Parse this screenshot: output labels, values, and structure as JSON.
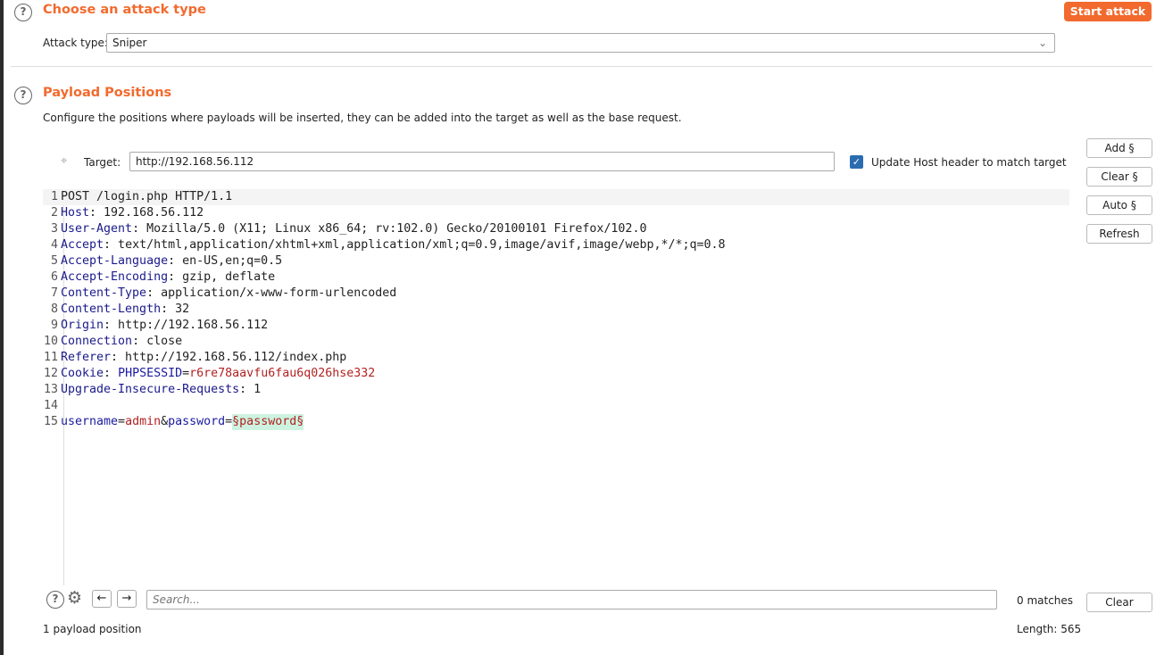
{
  "attack_section": {
    "title": "Choose an attack type",
    "start_attack": "Start attack",
    "attack_type_label": "Attack type:",
    "attack_type_value": "Sniper"
  },
  "positions_section": {
    "title": "Payload Positions",
    "description": "Configure the positions where payloads will be inserted, they can be added into the target as well as the base request.",
    "target_label": "Target:",
    "target_value": "http://192.168.56.112",
    "update_host_label": "Update Host header to match target",
    "update_host_checked": true
  },
  "side_buttons": {
    "add": "Add §",
    "clear": "Clear §",
    "auto": "Auto §",
    "refresh": "Refresh"
  },
  "request_lines": [
    [
      {
        "t": "POST /login.php HTTP/1.1",
        "c": "val"
      }
    ],
    [
      {
        "t": "Host",
        "c": "key"
      },
      {
        "t": ": 192.168.56.112",
        "c": "val"
      }
    ],
    [
      {
        "t": "User-Agent",
        "c": "key"
      },
      {
        "t": ": Mozilla/5.0 (X11; Linux x86_64; rv:102.0) Gecko/20100101 Firefox/102.0",
        "c": "val"
      }
    ],
    [
      {
        "t": "Accept",
        "c": "key"
      },
      {
        "t": ": text/html,application/xhtml+xml,application/xml;q=0.9,image/avif,image/webp,*/*;q=0.8",
        "c": "val"
      }
    ],
    [
      {
        "t": "Accept-Language",
        "c": "key"
      },
      {
        "t": ": en-US,en;q=0.5",
        "c": "val"
      }
    ],
    [
      {
        "t": "Accept-Encoding",
        "c": "key"
      },
      {
        "t": ": gzip, deflate",
        "c": "val"
      }
    ],
    [
      {
        "t": "Content-Type",
        "c": "key"
      },
      {
        "t": ": application/x-www-form-urlencoded",
        "c": "val"
      }
    ],
    [
      {
        "t": "Content-Length",
        "c": "key"
      },
      {
        "t": ": 32",
        "c": "val"
      }
    ],
    [
      {
        "t": "Origin",
        "c": "key"
      },
      {
        "t": ": http://192.168.56.112",
        "c": "val"
      }
    ],
    [
      {
        "t": "Connection",
        "c": "key"
      },
      {
        "t": ": close",
        "c": "val"
      }
    ],
    [
      {
        "t": "Referer",
        "c": "key"
      },
      {
        "t": ": http://192.168.56.112/index.php",
        "c": "val"
      }
    ],
    [
      {
        "t": "Cookie",
        "c": "key"
      },
      {
        "t": ": ",
        "c": "val"
      },
      {
        "t": "PHPSESSID",
        "c": "param"
      },
      {
        "t": "=",
        "c": "val"
      },
      {
        "t": "r6re78aavfu6fau6q026hse332",
        "c": "pval"
      }
    ],
    [
      {
        "t": "Upgrade-Insecure-Requests",
        "c": "key"
      },
      {
        "t": ": 1",
        "c": "val"
      }
    ],
    [],
    [
      {
        "t": "username",
        "c": "param"
      },
      {
        "t": "=",
        "c": "val"
      },
      {
        "t": "admin",
        "c": "pval"
      },
      {
        "t": "&",
        "c": "val"
      },
      {
        "t": "password",
        "c": "param"
      },
      {
        "t": "=",
        "c": "val"
      },
      {
        "t": "§password§",
        "c": "marker"
      }
    ]
  ],
  "search": {
    "placeholder": "Search...",
    "matches": "0 matches",
    "clear": "Clear"
  },
  "status": {
    "payload_positions": "1 payload position",
    "length": "Length: 565"
  },
  "colors": {
    "accent": "#f26a2e",
    "checkbox": "#2b6cb0",
    "marker_bg": "#cdf3e0"
  }
}
